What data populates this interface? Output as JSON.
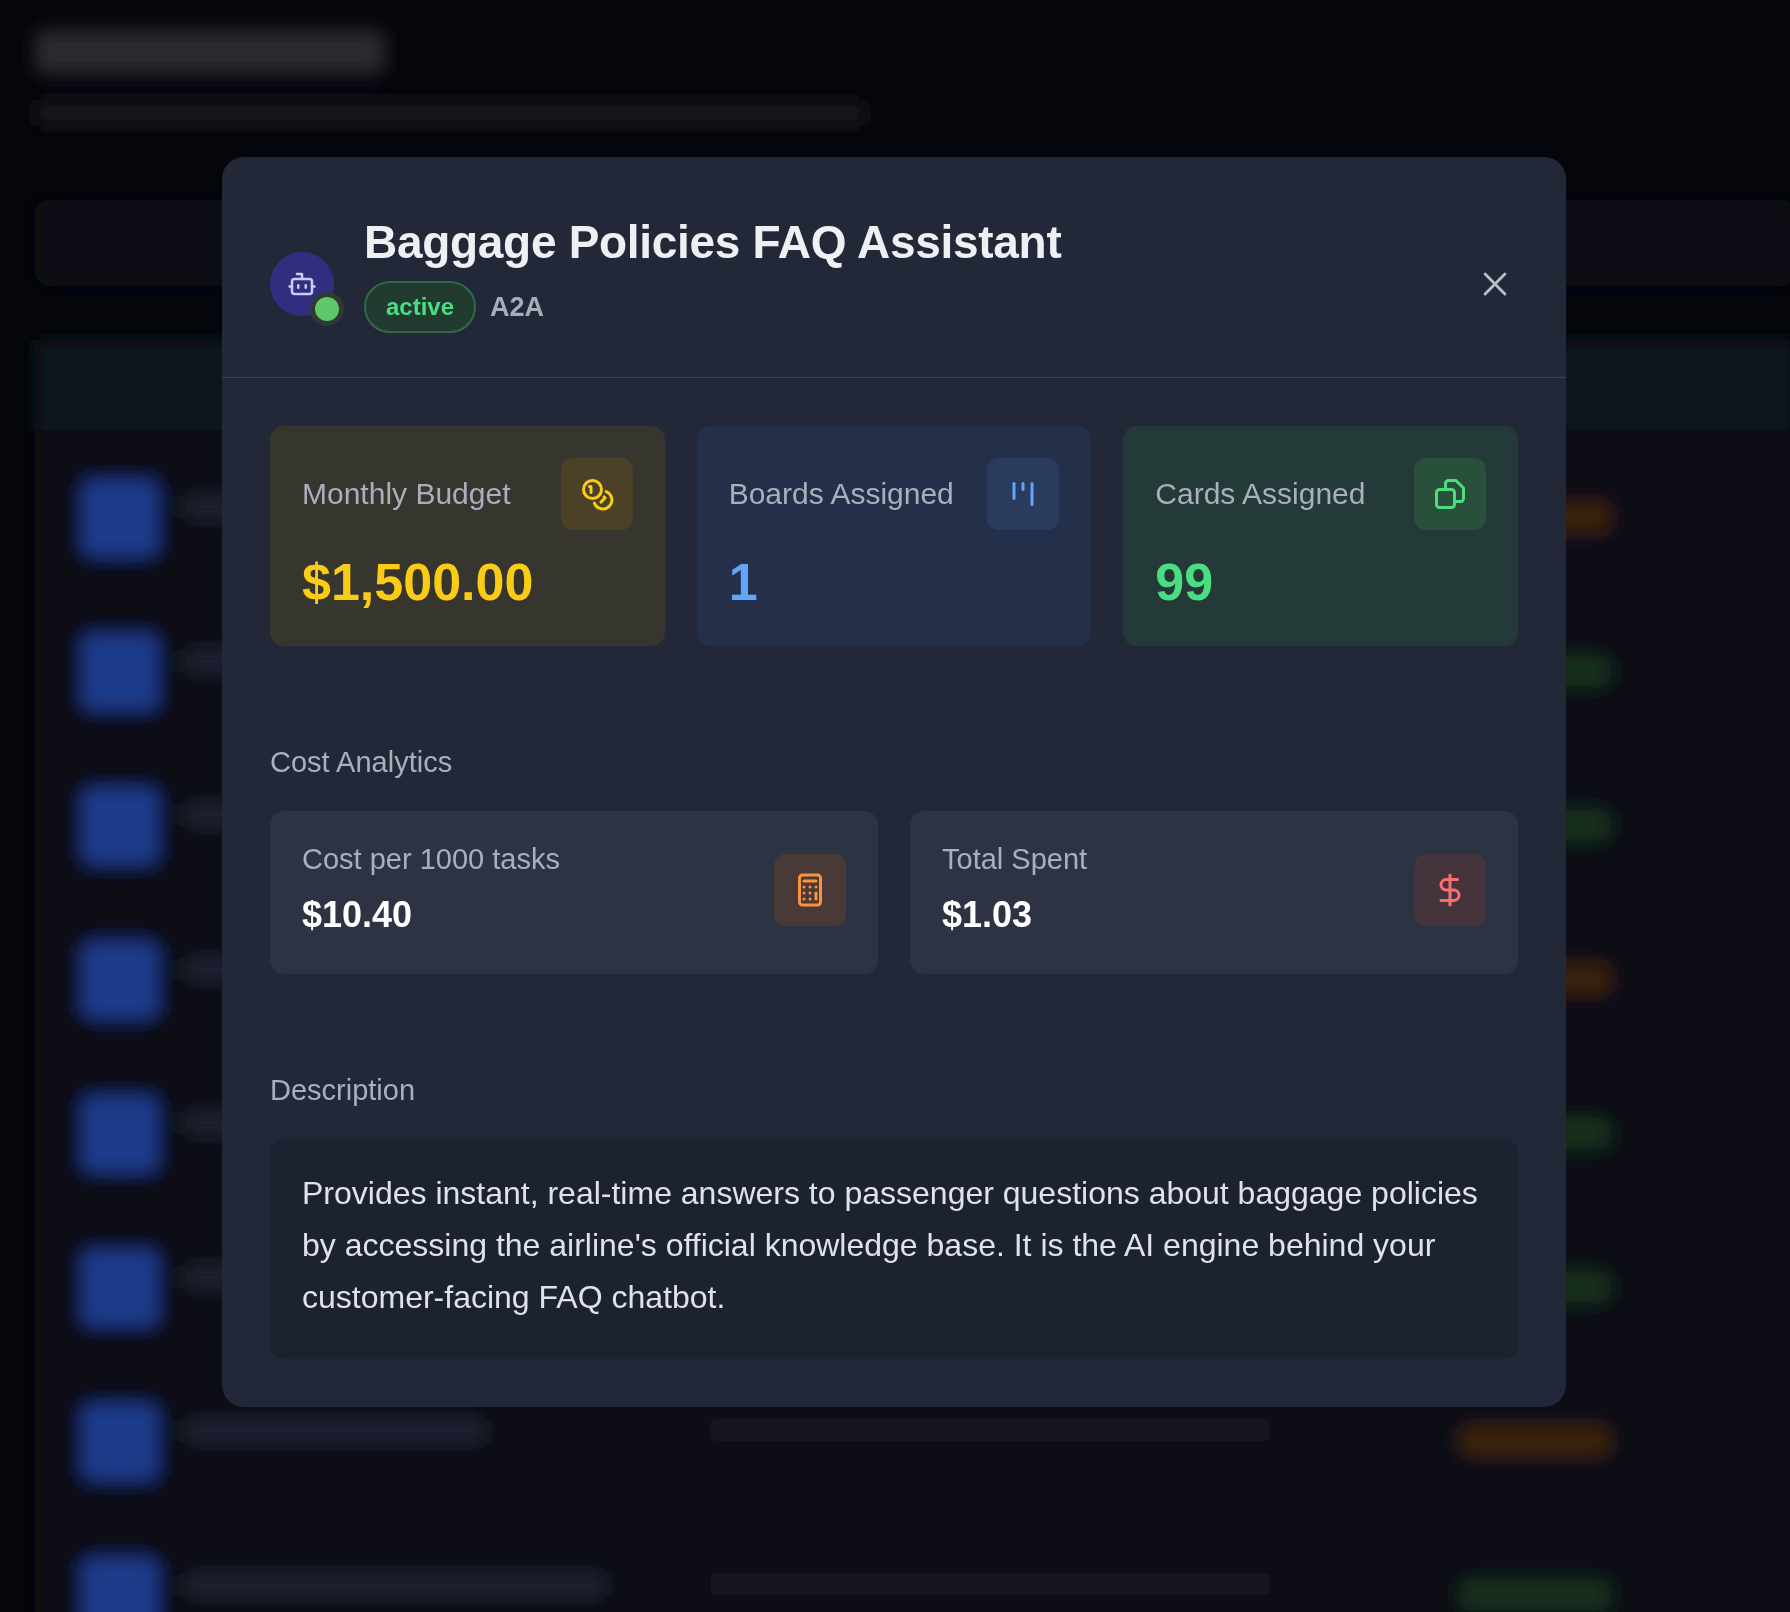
{
  "agent": {
    "name": "Baggage Policies FAQ Assistant",
    "online": true,
    "status": "active",
    "protocol": "A2A"
  },
  "stats": [
    {
      "kind": "budget",
      "label": "Monthly Budget",
      "value": "$1,500.00"
    },
    {
      "kind": "boards",
      "label": "Boards Assigned",
      "value": "1"
    },
    {
      "kind": "cards",
      "label": "Cards Assigned",
      "value": "99"
    }
  ],
  "cost_analytics": {
    "title": "Cost Analytics",
    "items": [
      {
        "kind": "calculator",
        "label": "Cost per 1000 tasks",
        "value": "$10.40"
      },
      {
        "kind": "dollar",
        "label": "Total Spent",
        "value": "$1.03"
      }
    ]
  },
  "description": {
    "title": "Description",
    "text": "Provides instant, real-time answers to passenger questions about baggage policies by accessing the airline's official knowledge base. It is the AI engine behind your customer-facing FAQ chatbot."
  }
}
